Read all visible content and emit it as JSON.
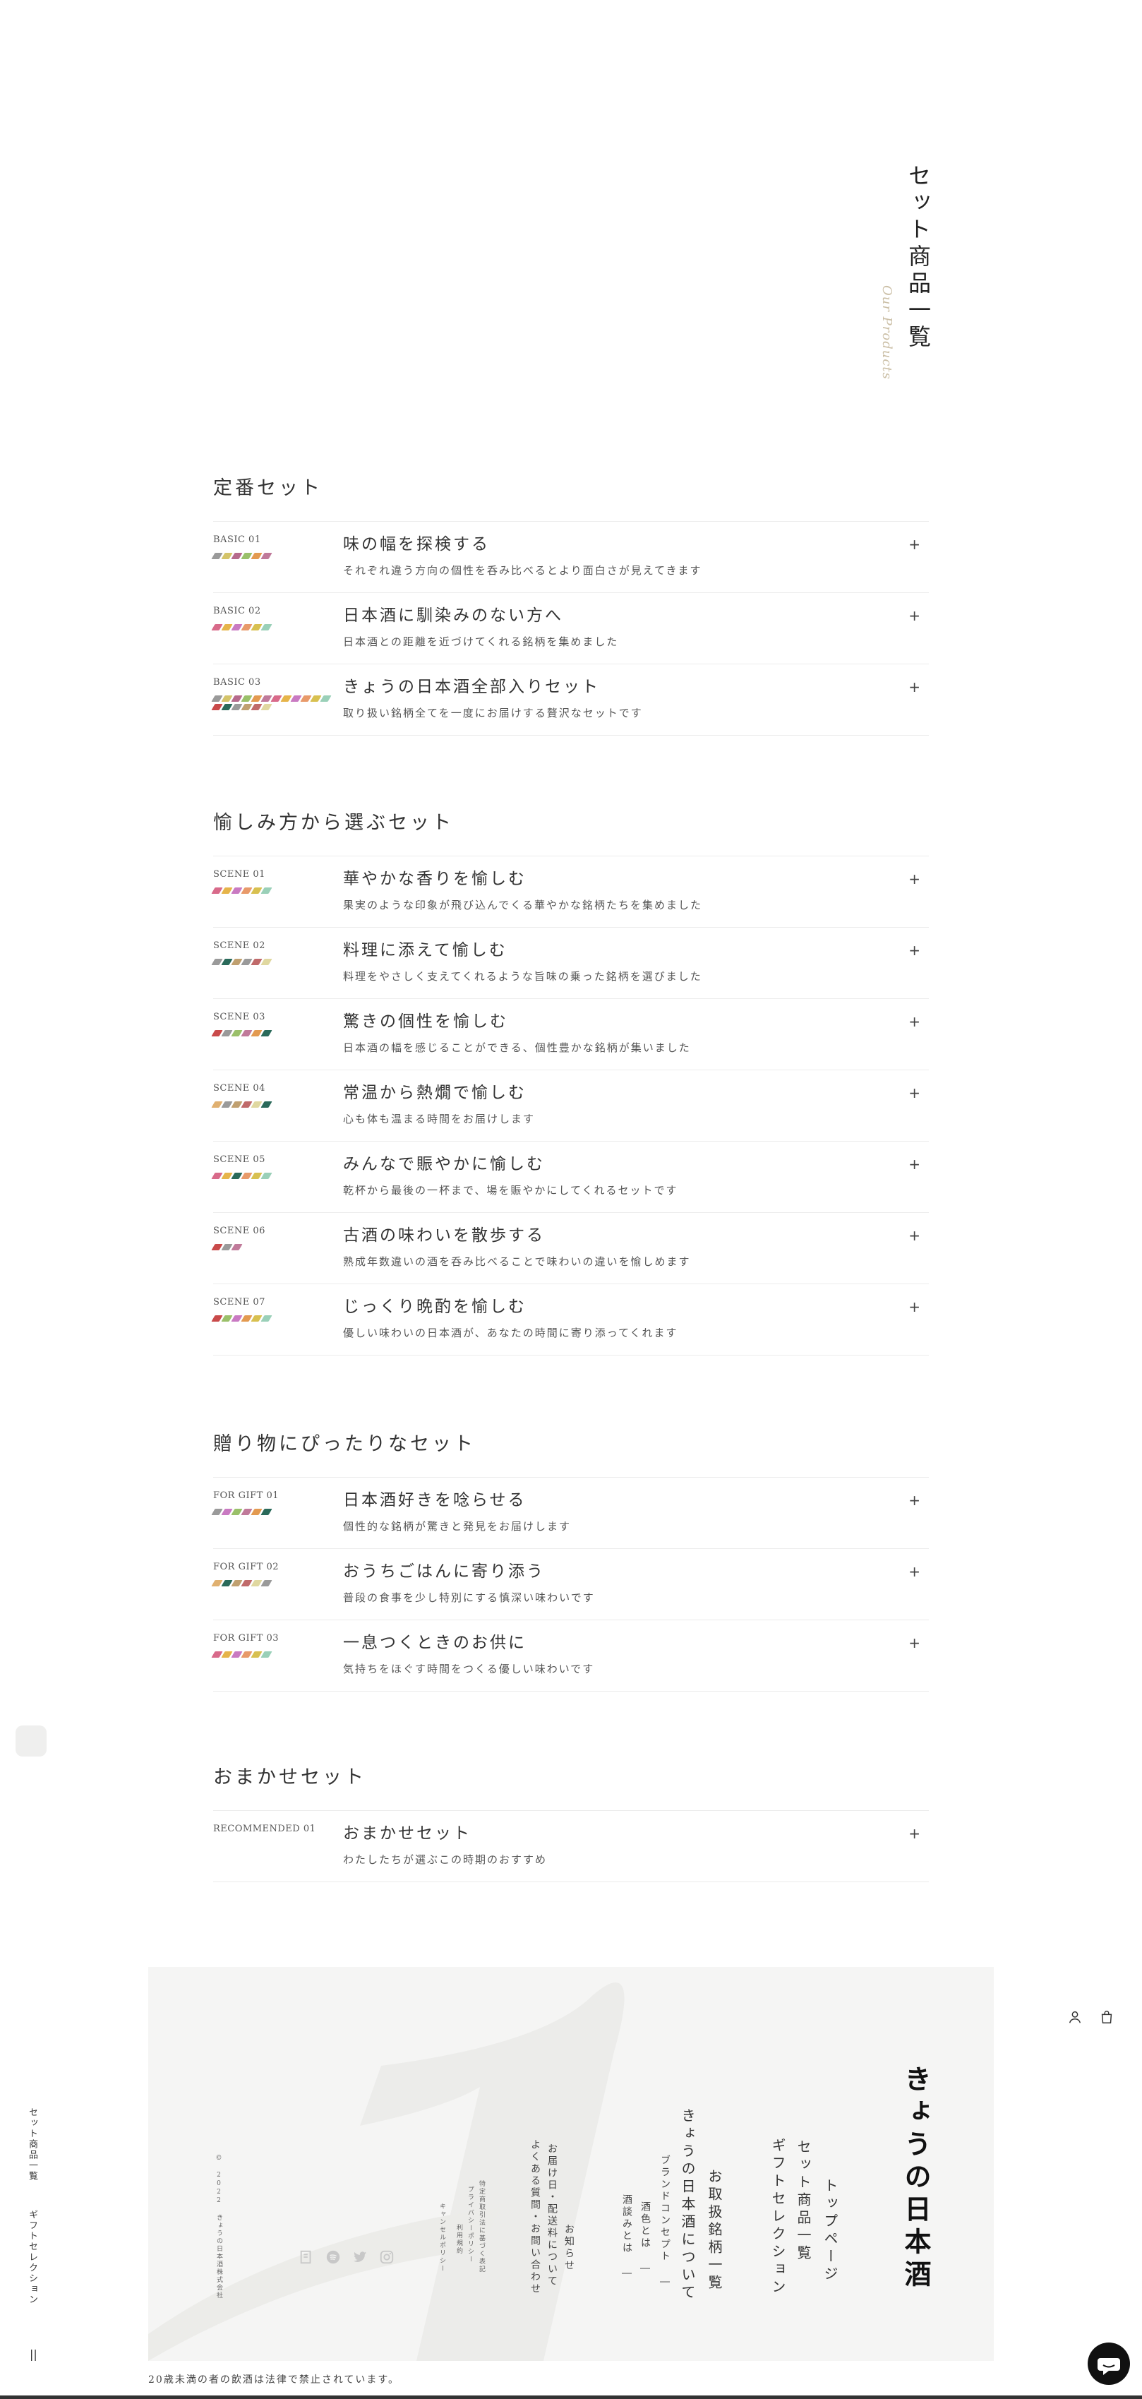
{
  "page": {
    "title": "セット商品一覧",
    "subtitle": "Our Products"
  },
  "sections": [
    {
      "heading": "定番セット",
      "items": [
        {
          "label": "BASIC 01",
          "title": "味の幅を探検する",
          "desc": "それぞれ違う方向の個性を呑み比べるとより面白さが見えてきます",
          "swatches": [
            "#9a9a9a",
            "#d4c46a",
            "#b66a8c",
            "#9ac06a",
            "#e39a50",
            "#c07a9a"
          ]
        },
        {
          "label": "BASIC 02",
          "title": "日本酒に馴染みのない方へ",
          "desc": "日本酒との距離を近づけてくれる銘柄を集めました",
          "swatches": [
            "#d86a8a",
            "#e6b44a",
            "#c97ac2",
            "#e89a6a",
            "#d8c050",
            "#9ad0b8"
          ]
        },
        {
          "label": "BASIC 03",
          "title": "きょうの日本酒全部入りセット",
          "desc": "取り扱い銘柄全てを一度にお届けする贅沢なセットです",
          "swatches": [
            "#9a9a9a",
            "#d4c46a",
            "#b66a8c",
            "#9ac06a",
            "#e39a50",
            "#c07a9a",
            "#d86a8a",
            "#e6b44a",
            "#c97ac2",
            "#e89a6a",
            "#d8c050",
            "#9ad0b8",
            "#c94a4a",
            "#2a6a5a",
            "#9a9a9a",
            "#c0a070",
            "#c06a6a",
            "#e0d8a0"
          ]
        }
      ]
    },
    {
      "heading": "愉しみ方から選ぶセット",
      "items": [
        {
          "label": "SCENE 01",
          "title": "華やかな香りを愉しむ",
          "desc": "果実のような印象が飛び込んでくる華やかな銘柄たちを集めました",
          "swatches": [
            "#d86a8a",
            "#e6b44a",
            "#c97ac2",
            "#e89a6a",
            "#d8c050",
            "#9ad0b8"
          ]
        },
        {
          "label": "SCENE 02",
          "title": "料理に添えて愉しむ",
          "desc": "料理をやさしく支えてくれるような旨味の乗った銘柄を選びました",
          "swatches": [
            "#9a9a9a",
            "#2a6a5a",
            "#c0a070",
            "#9a9a9a",
            "#c06a6a",
            "#e0d8a0"
          ]
        },
        {
          "label": "SCENE 03",
          "title": "驚きの個性を愉しむ",
          "desc": "日本酒の幅を感じることができる、個性豊かな銘柄が集いました",
          "swatches": [
            "#c94a4a",
            "#9a9a9a",
            "#9ac06a",
            "#c07a9a",
            "#e39a50",
            "#2a6a5a"
          ]
        },
        {
          "label": "SCENE 04",
          "title": "常温から熱燗で愉しむ",
          "desc": "心も体も温まる時間をお届けします",
          "swatches": [
            "#e0b070",
            "#9a9a9a",
            "#c0a070",
            "#c06a6a",
            "#e0d8a0",
            "#2a6a5a"
          ]
        },
        {
          "label": "SCENE 05",
          "title": "みんなで賑やかに愉しむ",
          "desc": "乾杯から最後の一杯まで、場を賑やかにしてくれるセットです",
          "swatches": [
            "#d86a8a",
            "#e6b44a",
            "#2a6a5a",
            "#e89a6a",
            "#d8c050",
            "#9ad0b8"
          ]
        },
        {
          "label": "SCENE 06",
          "title": "古酒の味わいを散歩する",
          "desc": "熟成年数違いの酒を呑み比べることで味わいの違いを愉しめます",
          "swatches": [
            "#c94a4a",
            "#9a9a9a",
            "#c07a9a"
          ]
        },
        {
          "label": "SCENE 07",
          "title": "じっくり晩酌を愉しむ",
          "desc": "優しい味わいの日本酒が、あなたの時間に寄り添ってくれます",
          "swatches": [
            "#c94a4a",
            "#9ac06a",
            "#c97ac2",
            "#e39a50",
            "#d8c050",
            "#9ad0b8"
          ]
        }
      ]
    },
    {
      "heading": "贈り物にぴったりなセット",
      "items": [
        {
          "label": "FOR GIFT 01",
          "title": "日本酒好きを唸らせる",
          "desc": "個性的な銘柄が驚きと発見をお届けします",
          "swatches": [
            "#9a9a9a",
            "#c97ac2",
            "#9ac06a",
            "#c07a9a",
            "#e39a50",
            "#2a6a5a"
          ]
        },
        {
          "label": "FOR GIFT 02",
          "title": "おうちごはんに寄り添う",
          "desc": "普段の食事を少し特別にする慎深い味わいです",
          "swatches": [
            "#e0b070",
            "#2a6a5a",
            "#c0a070",
            "#c06a6a",
            "#e0d8a0",
            "#9a9a9a"
          ]
        },
        {
          "label": "FOR GIFT 03",
          "title": "一息つくときのお供に",
          "desc": "気持ちをほぐす時間をつくる優しい味わいです",
          "swatches": [
            "#d86a8a",
            "#e6b44a",
            "#c97ac2",
            "#e89a6a",
            "#d8c050",
            "#9ad0b8"
          ]
        }
      ]
    },
    {
      "heading": "おまかせセット",
      "items": [
        {
          "label": "RECOMMENDED 01",
          "title": "おまかせセット",
          "desc": "わたしたちが選ぶこの時期のおすすめ",
          "swatches": []
        }
      ]
    }
  ],
  "side_nav": {
    "links": [
      "セット商品一覧",
      "ギフトセレクション"
    ],
    "bar": "||"
  },
  "footer": {
    "brand": "きょうの日本酒",
    "main_nav": [
      "トップページ",
      "セット商品一覧",
      "ギフトセレクション",
      "お取扱銘柄一覧",
      "きょうの日本酒について"
    ],
    "sub_nav": [
      "ブランドコンセプト ―",
      "酒色とは ―",
      "酒談みとは ―"
    ],
    "info_nav": [
      "お知らせ",
      "お届け日・配送料について",
      "よくある質問・お問い合わせ"
    ],
    "legal_nav": [
      "特定商取引法に基づく表記",
      "プライバシーポリシー",
      "利用規約",
      "キャンセルポリシー"
    ],
    "copyright": "© 2022 きょうの日本酒株式会社",
    "social_icons": [
      "instagram-icon",
      "twitter-icon",
      "spotify-icon",
      "note-icon"
    ]
  },
  "header_icons": [
    "account-icon",
    "cart-icon"
  ],
  "notice": "20歳未満の者の飲酒は法律で禁止されています。"
}
